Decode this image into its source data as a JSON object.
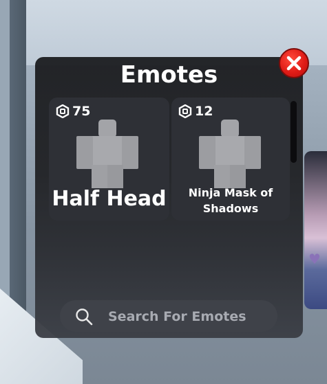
{
  "panel": {
    "title": "Emotes",
    "close_icon": "close-icon"
  },
  "items": [
    {
      "price": "75",
      "name": "Half Head",
      "currency_icon": "robux-icon"
    },
    {
      "price": "12",
      "name": "Ninja Mask of Shadows",
      "currency_icon": "robux-icon"
    }
  ],
  "search": {
    "placeholder": "Search For Emotes",
    "value": "",
    "icon": "search-icon"
  },
  "colors": {
    "close_button": "#e01c17",
    "panel_bg": "#1f2023",
    "card_bg": "#2e3036",
    "search_bg": "#3f4249"
  }
}
